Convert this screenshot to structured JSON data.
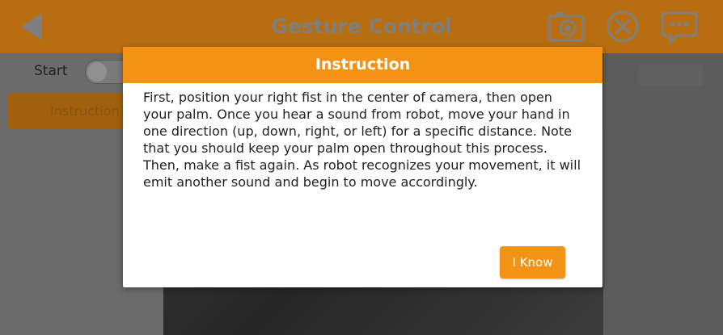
{
  "header": {
    "title": "Gesture Control"
  },
  "controls": {
    "start_label": "Start",
    "instruction_tab_label": "Instruction"
  },
  "dialog": {
    "title": "Instruction",
    "body": "First, position your right fist in the center of camera, then open your palm. Once you hear a sound from robot, move your hand in one direction (up, down, right, or left) for a specific distance. Note that you should keep your palm open throughout this process. Then, make a fist again. As robot recognizes your movement, it will emit another sound and begin to move accordingly.",
    "confirm_label": "I Know"
  },
  "icons": {
    "back": "back-arrow-icon",
    "camera": "camera-icon",
    "close": "close-circle-icon",
    "chat": "chat-bubble-icon"
  },
  "colors": {
    "accent": "#f39316",
    "dimmed_accent": "#b86e10"
  }
}
